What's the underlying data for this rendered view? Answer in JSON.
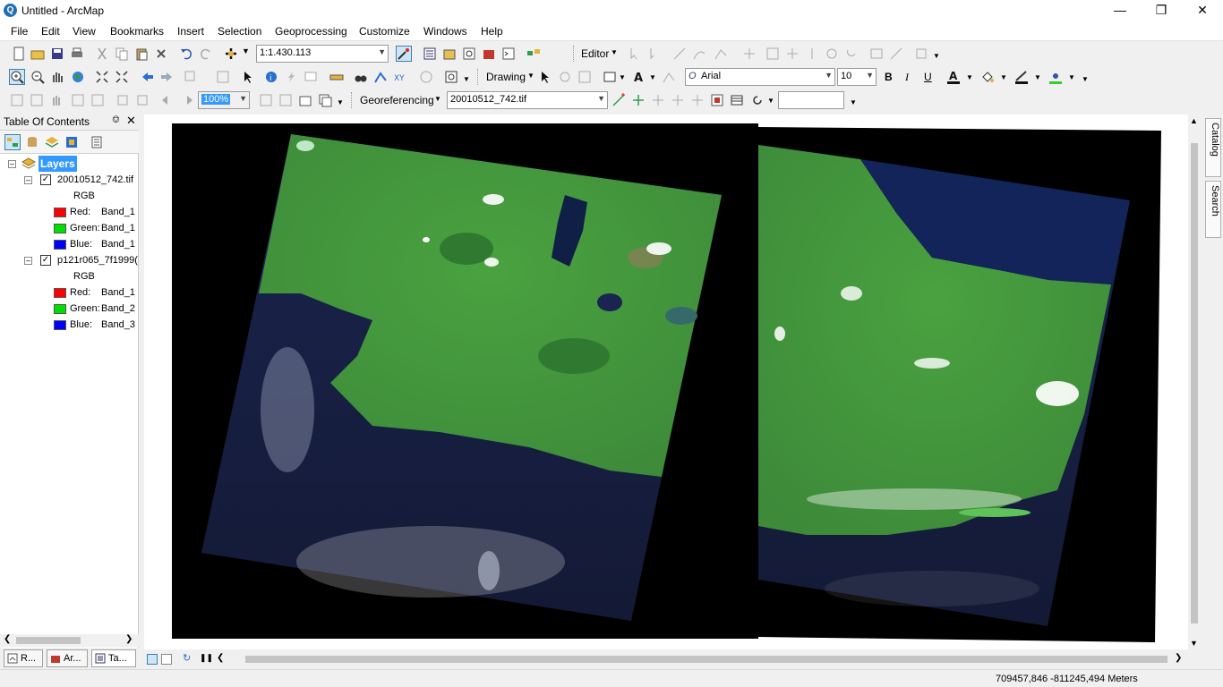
{
  "window": {
    "title": "Untitled - ArcMap",
    "app_icon_glyph": "Q"
  },
  "menu": [
    "File",
    "Edit",
    "View",
    "Bookmarks",
    "Insert",
    "Selection",
    "Geoprocessing",
    "Customize",
    "Windows",
    "Help"
  ],
  "toolbar": {
    "scale": "1:1.430.113",
    "editor_label": "Editor",
    "drawing_label": "Drawing",
    "font_name": "Arial",
    "font_size": "10",
    "bold": "B",
    "italic": "I",
    "underline": "U",
    "zoom_percent": "100%",
    "georef_label": "Georeferencing",
    "georef_layer": "20010512_742.tif",
    "georef_input": ""
  },
  "toc": {
    "title": "Table Of Contents",
    "root": "Layers",
    "layers": [
      {
        "name": "20010512_742.tif",
        "render": "RGB",
        "bands": [
          {
            "channel": "Red:",
            "band": "Band_1",
            "color": "#ff0000"
          },
          {
            "channel": "Green:",
            "band": "Band_1",
            "color": "#00e000"
          },
          {
            "channel": "Blue:",
            "band": "Band_1",
            "color": "#0000ff"
          }
        ]
      },
      {
        "name": "p121r065_7f1999(",
        "render": "RGB",
        "bands": [
          {
            "channel": "Red:",
            "band": "Band_1",
            "color": "#ff0000"
          },
          {
            "channel": "Green:",
            "band": "Band_2",
            "color": "#00e000"
          },
          {
            "channel": "Blue:",
            "band": "Band_3",
            "color": "#0000ff"
          }
        ]
      }
    ]
  },
  "bottom_tabs": [
    "R...",
    "Ar...",
    "Ta..."
  ],
  "right_dock": [
    "Catalog",
    "Search"
  ],
  "status": {
    "coordinates": "709457,846  -811245,494 Meters"
  },
  "colors": {
    "land": "#3f9a3a",
    "sea": "#0d1a45",
    "selection": "#3399ff"
  }
}
